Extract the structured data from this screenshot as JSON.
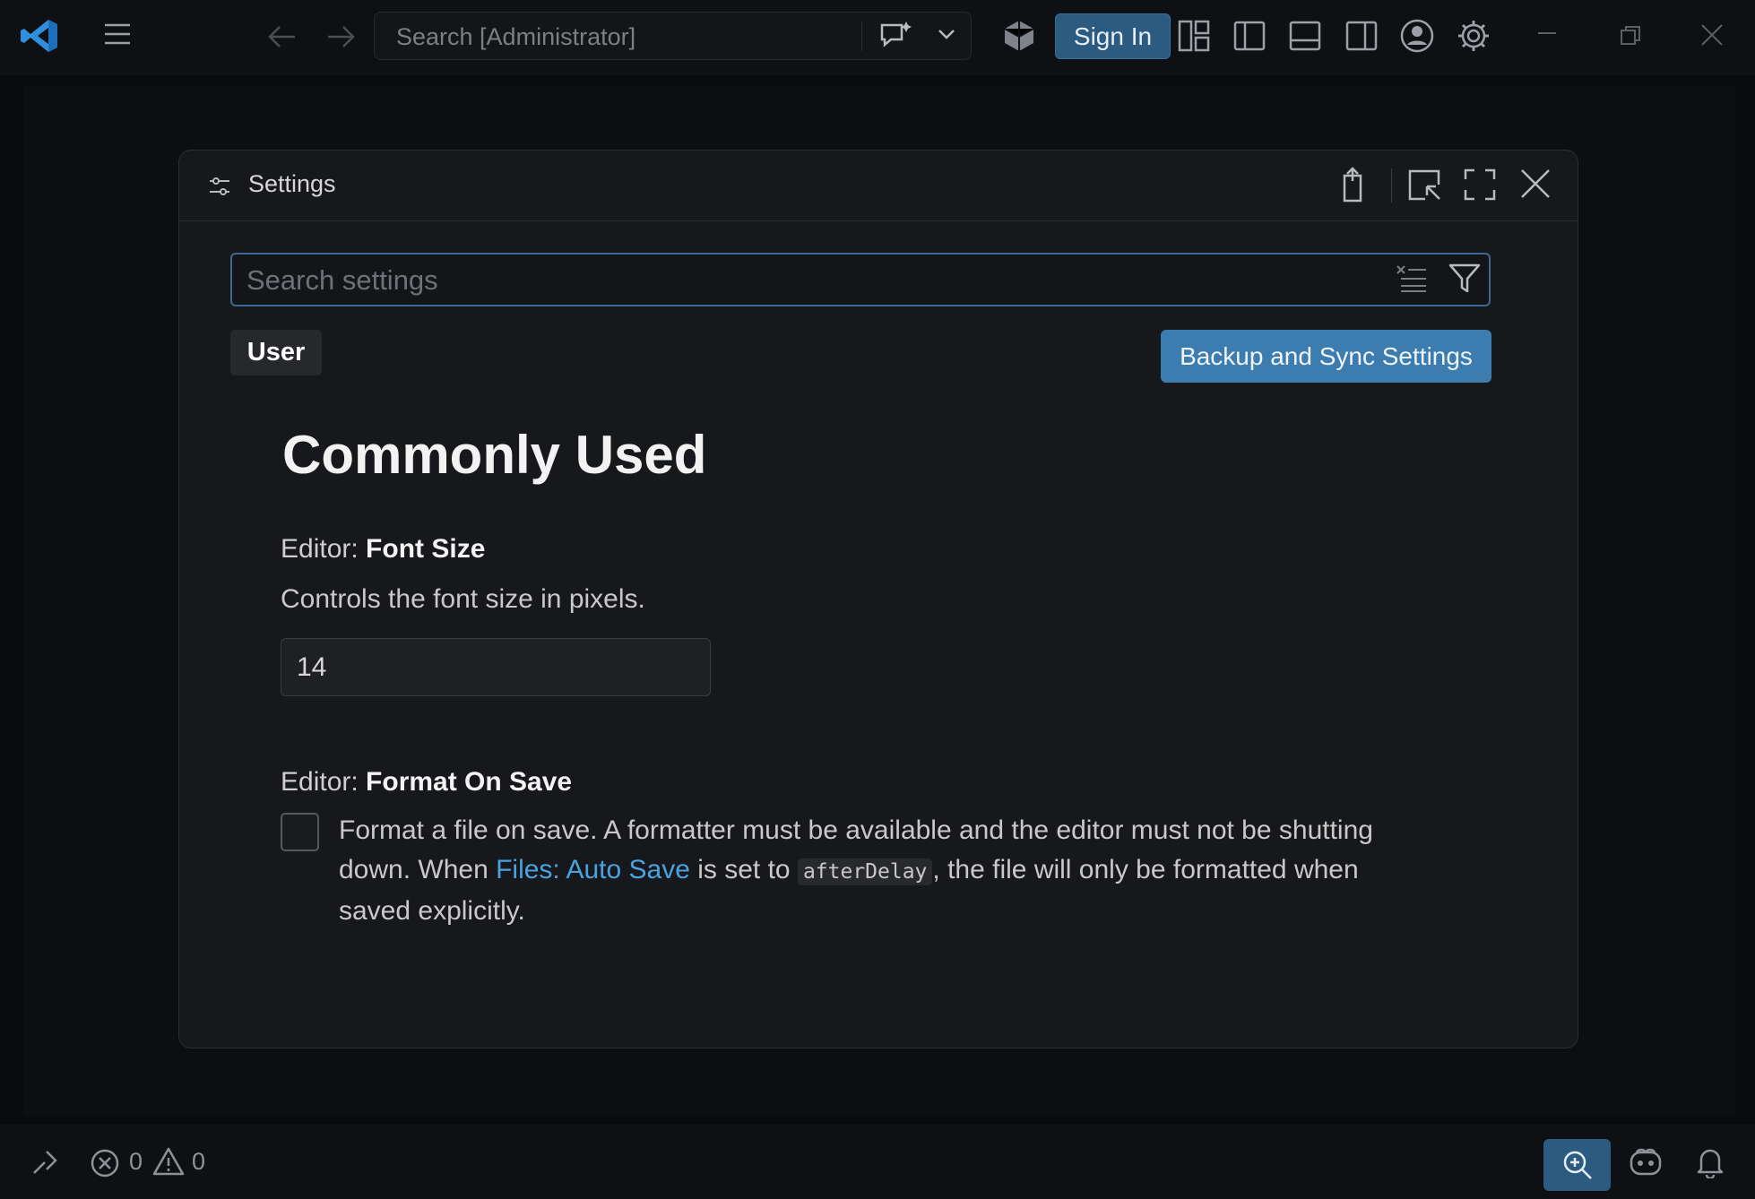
{
  "titlebar": {
    "search_placeholder": "Search [Administrator]",
    "sign_in_label": "Sign In",
    "accent_color": "#2b5b80"
  },
  "settings": {
    "title": "Settings",
    "search_placeholder": "Search settings",
    "tab_user": "User",
    "backup_button": "Backup and Sync Settings",
    "section_title": "Commonly Used",
    "font_size": {
      "category": "Editor: ",
      "name": "Font Size",
      "description": "Controls the font size in pixels.",
      "value": "14"
    },
    "format_on_save": {
      "category": "Editor: ",
      "name": "Format On Save",
      "checked": false,
      "desc_part1": "Format a file on save. A formatter must be available and the editor must not be shutting down. When ",
      "desc_link": "Files: Auto Save",
      "desc_part2": " is set to ",
      "desc_code": "afterDelay",
      "desc_part3": ", the file will only be formatted when saved explicitly."
    }
  },
  "statusbar": {
    "errors": "0",
    "warnings": "0"
  },
  "icons": {
    "app_logo": "vscode-logo-icon",
    "menu": "hamburger-menu-icon",
    "back": "arrow-left-icon",
    "forward": "arrow-right-icon",
    "chat": "chat-sparkle-icon",
    "chevron": "chevron-down-icon",
    "copilot": "copilot-icon",
    "layouts": [
      "layout-customize-icon",
      "toggle-primary-sidebar-icon",
      "toggle-panel-icon",
      "toggle-secondary-sidebar-icon"
    ],
    "account": "account-icon",
    "manage": "gear-icon",
    "window": [
      "minimize-icon",
      "restore-icon",
      "close-icon"
    ],
    "modal": [
      "settings-sliders-icon",
      "open-json-icon",
      "open-in-editor-icon",
      "maximize-icon",
      "close-icon"
    ],
    "search_actions": [
      "clear-filter-icon",
      "filter-icon"
    ],
    "status": [
      "remote-icon",
      "error-icon",
      "warning-icon",
      "zoom-icon",
      "copilot-icon",
      "bell-icon"
    ]
  }
}
